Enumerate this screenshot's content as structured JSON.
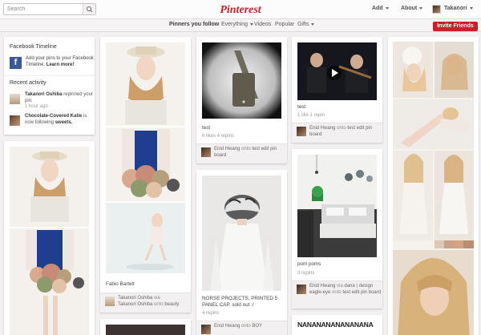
{
  "search": {
    "placeholder": "Search",
    "value": ""
  },
  "logo": {
    "text": "Pinterest"
  },
  "header_nav": {
    "add": "Add",
    "about": "About",
    "user": "Takanori"
  },
  "subnav": {
    "items": [
      "Pinners you follow",
      "Everything",
      "Videos",
      "Popular",
      "Gifts"
    ],
    "invite": "Invite Friends"
  },
  "colors": {
    "brand_red": "#cb2027",
    "facebook_blue": "#3b5998",
    "background": "#f2f0f0"
  },
  "sidebar": {
    "fb_title": "Facebook Timeline",
    "fb_text": "Add your pins to your Facebook Timeline.",
    "fb_link": "Learn more!",
    "recent_title": "Recent activity",
    "activity": [
      {
        "user": "Takanori Oshiba",
        "action": "repinned your pin.",
        "time": "1 hour ago"
      },
      {
        "user": "Chocolate-Covered Katie",
        "action": "is now following",
        "target": "sweets."
      }
    ]
  },
  "pins": {
    "fabio": {
      "desc": "Fabio Bartelt",
      "pinner": "Takanori Oshiba",
      "via": "via",
      "pinner2": "Takanori Oshiba",
      "onto": "onto",
      "board": "beauty"
    },
    "bag": {
      "desc": "test",
      "stats": "6 likes  4 repins",
      "pinner": "Enid Hwang",
      "onto": "onto",
      "board": "test edit pin board"
    },
    "hat": {
      "desc": "NORSE PROJECTS, PRINTED 5 PANEL CAP. sold out :/",
      "stats": "4 repins",
      "pinner": "Enid Hwang",
      "onto": "onto",
      "board": "BOY"
    },
    "violin": {
      "desc": "test",
      "stats": "1 like  1 repin",
      "pinner": "Enid Hwang",
      "onto": "onto",
      "board": "test edit pin board"
    },
    "room": {
      "desc": "pom poms",
      "stats": "3 repins",
      "pinner": "Enid Hwang",
      "via": "via",
      "pinner2": "dana | design eagle-eye",
      "onto": "onto",
      "board": "test edit pin board"
    },
    "banner": {
      "text": "NANANANANANANANA"
    }
  }
}
